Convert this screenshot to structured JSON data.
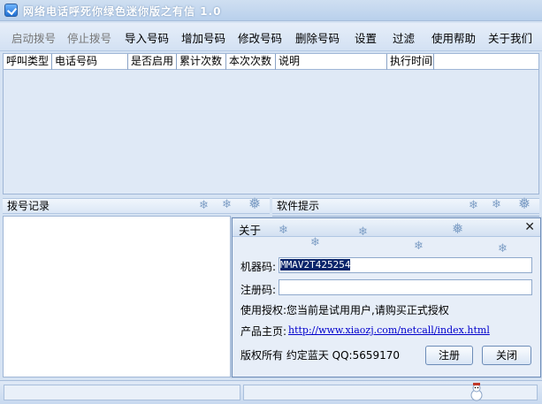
{
  "window": {
    "title": "网络电话呼死你绿色迷你版之有信 1.0"
  },
  "toolbar": {
    "buttons": [
      {
        "label": "启动拨号",
        "enabled": false
      },
      {
        "label": "停止拨号",
        "enabled": false
      },
      {
        "label": "导入号码",
        "enabled": true
      },
      {
        "label": "增加号码",
        "enabled": true
      },
      {
        "label": "修改号码",
        "enabled": true
      },
      {
        "label": "删除号码",
        "enabled": true
      },
      {
        "label": "设置",
        "enabled": true
      },
      {
        "label": "过滤",
        "enabled": true
      },
      {
        "label": "使用帮助",
        "enabled": true
      },
      {
        "label": "关于我们",
        "enabled": true
      }
    ]
  },
  "table": {
    "columns": [
      "呼叫类型",
      "电话号码",
      "是否启用",
      "累计次数",
      "本次次数",
      "说明",
      "执行时间"
    ],
    "rows": []
  },
  "panels": {
    "log_title": "拨号记录",
    "tips_title": "软件提示"
  },
  "about_dialog": {
    "title": "关于",
    "machine_code_label": "机器码:",
    "machine_code_value": "MMAV2T425254",
    "register_code_label": "注册码:",
    "register_code_value": "",
    "license_label": "使用授权:",
    "license_value": "您当前是试用用户,请购买正式授权",
    "homepage_label": "产品主页:",
    "homepage_url": "http://www.xiaozj.com/netcall/index.html",
    "copyright": "版权所有 约定蓝天 QQ:5659170",
    "register_button": "注册",
    "close_button": "关闭"
  },
  "icons": {
    "app": "app-check-icon",
    "decor": "snowflake-icon",
    "close": "close-icon",
    "status": "snowman-icon"
  },
  "colors": {
    "accent": "#0a246a",
    "link": "#0000cc",
    "header_bg": "#dbe7f6"
  }
}
